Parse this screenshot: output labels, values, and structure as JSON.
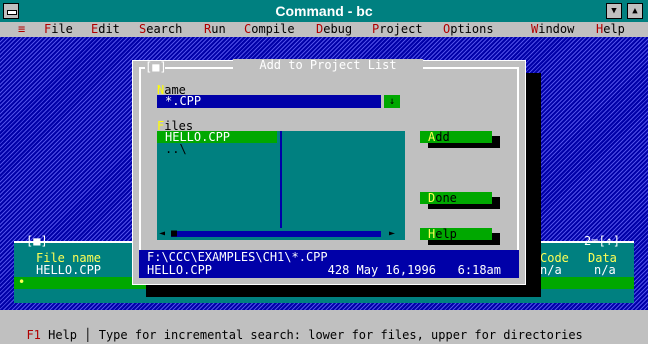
{
  "window": {
    "title": "Command - bc",
    "system_menu_icon": "system-menu-icon",
    "minimize_icon": "▼",
    "maximize_icon": "▲"
  },
  "menu": [
    {
      "hk": "≡",
      "rest": ""
    },
    {
      "hk": "F",
      "rest": "ile"
    },
    {
      "hk": "E",
      "rest": "dit"
    },
    {
      "hk": "S",
      "rest": "earch"
    },
    {
      "hk": "R",
      "rest": "un"
    },
    {
      "hk": "C",
      "rest": "ompile"
    },
    {
      "hk": "D",
      "rest": "ebug"
    },
    {
      "hk": "P",
      "rest": "roject"
    },
    {
      "hk": "O",
      "rest": "ptions"
    },
    {
      "hk": "W",
      "rest": "indow"
    },
    {
      "hk": "H",
      "rest": "elp"
    }
  ],
  "dialog": {
    "title": "Add to Project List",
    "close_box": "[■]",
    "name_label_hk": "N",
    "name_label_rest": "ame",
    "name_value": "*.CPP",
    "history_icon": "↓",
    "files_label_hk": "F",
    "files_label_rest": "iles",
    "files": [
      "HELLO.CPP",
      "..\\"
    ],
    "scroll_left": "◄",
    "scroll_right": "►",
    "scroll_thumb": "■",
    "buttons": [
      {
        "hk": "A",
        "rest": "dd"
      },
      {
        "hk": "D",
        "rest": "one"
      },
      {
        "hk": "H",
        "rest": "elp"
      }
    ],
    "path_line": "F:\\CCC\\EXAMPLES\\CH1\\*.CPP",
    "file_info": "HELLO.CPP                428 May 16,1996   6:18am"
  },
  "message_window": {
    "left_frame": "[■]",
    "right_frame": "2=[↑]",
    "col_file": "File name",
    "col_code": "Code",
    "col_data": "Data",
    "row_file": "HELLO.CPP",
    "row_code": "n/a",
    "row_data": "n/a",
    "bullet": "•"
  },
  "status": {
    "key": "F1",
    "key_label": " Help",
    "separator": " │ ",
    "message": "Type for incremental search: lower for files, upper for directories"
  }
}
